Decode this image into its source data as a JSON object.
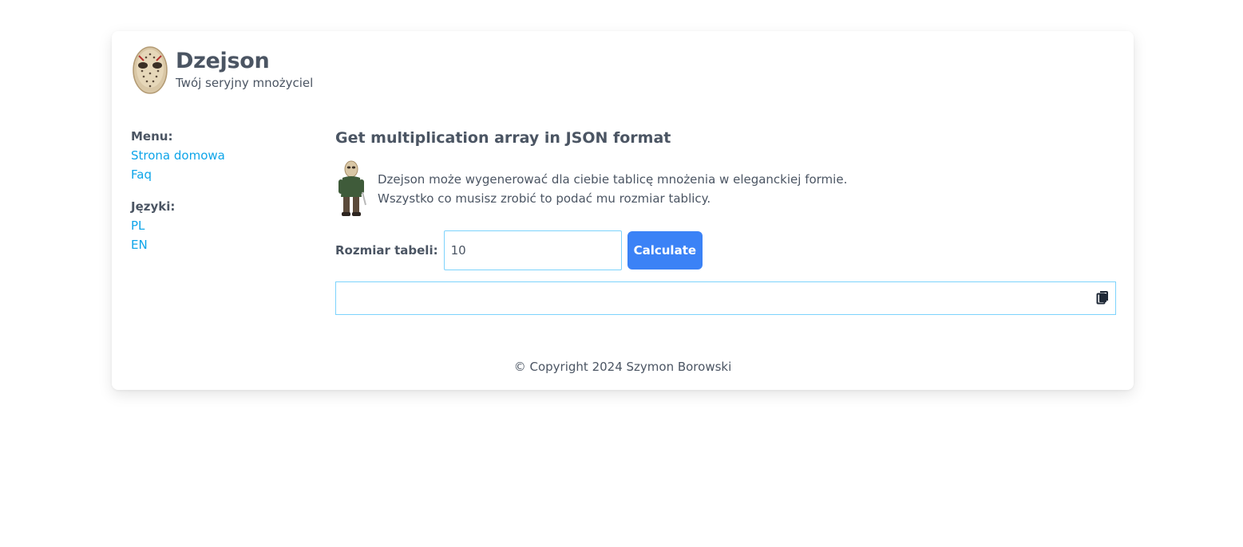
{
  "header": {
    "title": "Dzejson",
    "subtitle": "Twój seryjny mnożyciel",
    "logo_icon": "hockey-mask-icon"
  },
  "sidebar": {
    "menu_heading": "Menu:",
    "menu_items": [
      "Strona domowa",
      "Faq"
    ],
    "languages_heading": "Języki:",
    "language_items": [
      "PL",
      "EN"
    ]
  },
  "main": {
    "title": "Get multiplication array in JSON format",
    "intro_line1": "Dzejson może wygenerować dla ciebie tablicę mnożenia w eleganckiej formie.",
    "intro_line2": "Wszystko co musisz zrobić to podać mu rozmiar tablicy.",
    "form": {
      "size_label": "Rozmiar tabeli:",
      "size_value": "10",
      "calculate_label": "Calculate"
    },
    "output": {
      "value": "",
      "copy_icon": "copy-icon"
    }
  },
  "footer": {
    "copyright": "© Copyright 2024 Szymon Borowski"
  },
  "colors": {
    "link": "#0ea5e9",
    "button": "#3b82f6",
    "input_border": "#7dd3fc",
    "text": "#4b5563"
  }
}
